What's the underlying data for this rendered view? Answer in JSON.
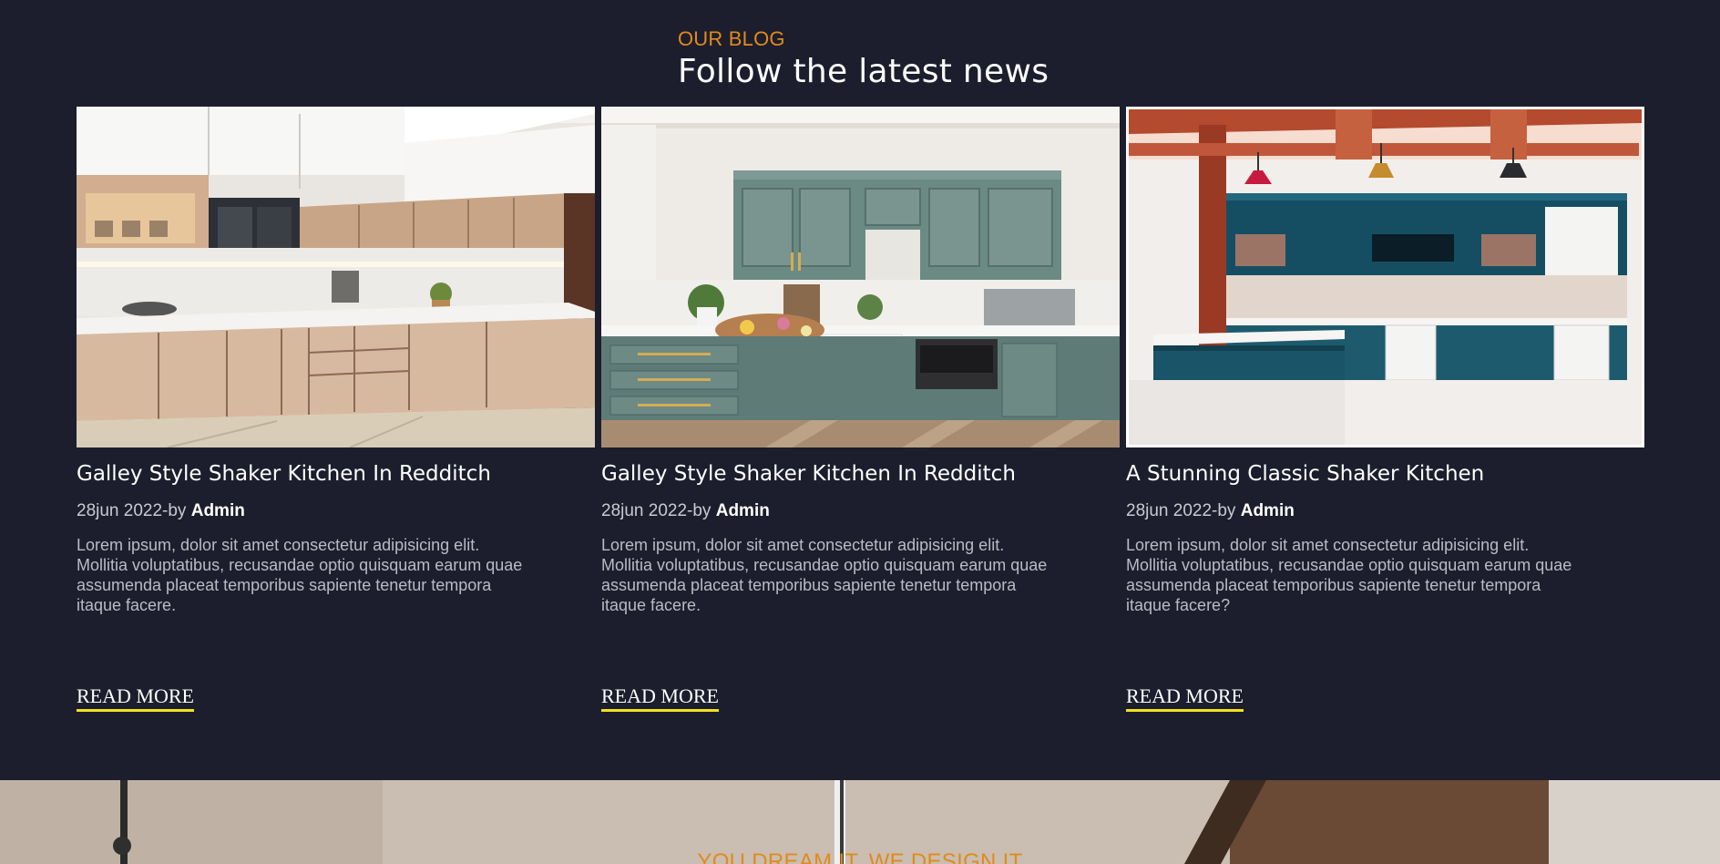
{
  "blog": {
    "kicker": "OUR BLOG",
    "heading": "Follow the latest news",
    "posts": [
      {
        "title": "Galley Style Shaker Kitchen In Redditch",
        "date": "28jun 2022-by ",
        "author": "Admin",
        "excerpt": "Lorem ipsum, dolor sit amet consectetur adipisicing elit. Mollitia voluptatibus, recusandae optio quisquam earum quae assumenda placeat temporibus sapiente tenetur tempora itaque facere.",
        "read_more": "READ MORE",
        "image_name": "beige-l-shaped-kitchen-photo"
      },
      {
        "title": "Galley Style Shaker Kitchen In Redditch",
        "date": "28jun 2022-by ",
        "author": "Admin",
        "excerpt": "Lorem ipsum, dolor sit amet consectetur adipisicing elit. Mollitia voluptatibus, recusandae optio quisquam earum quae assumenda placeat temporibus sapiente tenetur tempora itaque facere.",
        "read_more": "READ MORE",
        "image_name": "sage-green-shaker-kitchen-photo"
      },
      {
        "title": "A Stunning Classic Shaker Kitchen",
        "date": "28jun 2022-by ",
        "author": "Admin",
        "excerpt": "Lorem ipsum, dolor sit amet consectetur adipisicing elit. Mollitia voluptatibus, recusandae optio quisquam earum quae assumenda placeat temporibus sapiente tenetur tempora itaque facere?",
        "read_more": "READ MORE",
        "image_name": "teal-island-kitchen-photo"
      }
    ]
  },
  "hero": {
    "tagline": "YOU DREAM IT, WE DESIGN IT"
  },
  "colors": {
    "background": "#1c1e2d",
    "accent_orange": "#e28a1c",
    "underline_yellow": "#f2e21a"
  }
}
